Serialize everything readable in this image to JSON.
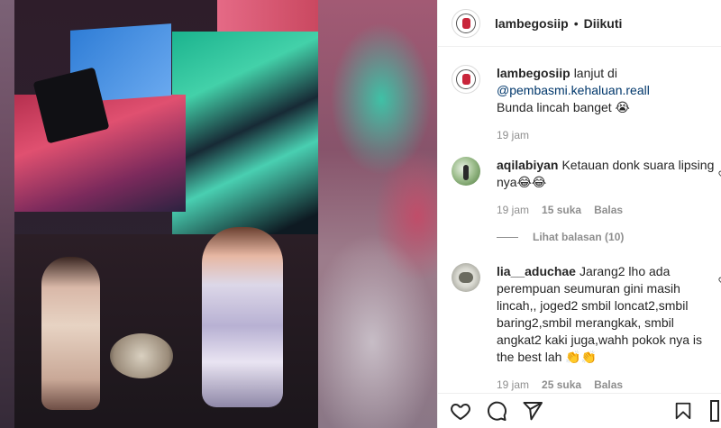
{
  "header": {
    "username": "lambegosiip",
    "separator": "•",
    "follow_status": "Diikuti"
  },
  "caption": {
    "username": "lambegosiip",
    "text_before": "lanjut di",
    "mention": "@pembasmi.kehaluan.reall",
    "text_after": "Bunda lincah banget 😭",
    "time": "19 jam"
  },
  "comments": [
    {
      "username": "aqilabiyan",
      "text": "Ketauan donk suara lipsing nya😂😂",
      "time": "19 jam",
      "likes": "15 suka",
      "reply_label": "Balas"
    },
    {
      "username": "lia__aduchae",
      "text": "Jarang2 lho ada perempuan seumuran gini masih lincah,, joged2 smbil loncat2,smbil baring2,smbil merangkak, smbil angkat2 kaki juga,wahh pokok nya is the best lah 👏👏",
      "time": "19 jam",
      "likes": "25 suka",
      "reply_label": "Balas"
    }
  ],
  "view_replies": "Lihat balasan (10)",
  "actions": {
    "like_icon": "heart-icon",
    "comment_icon": "comment-icon",
    "share_icon": "share-icon",
    "save_icon": "bookmark-icon"
  }
}
